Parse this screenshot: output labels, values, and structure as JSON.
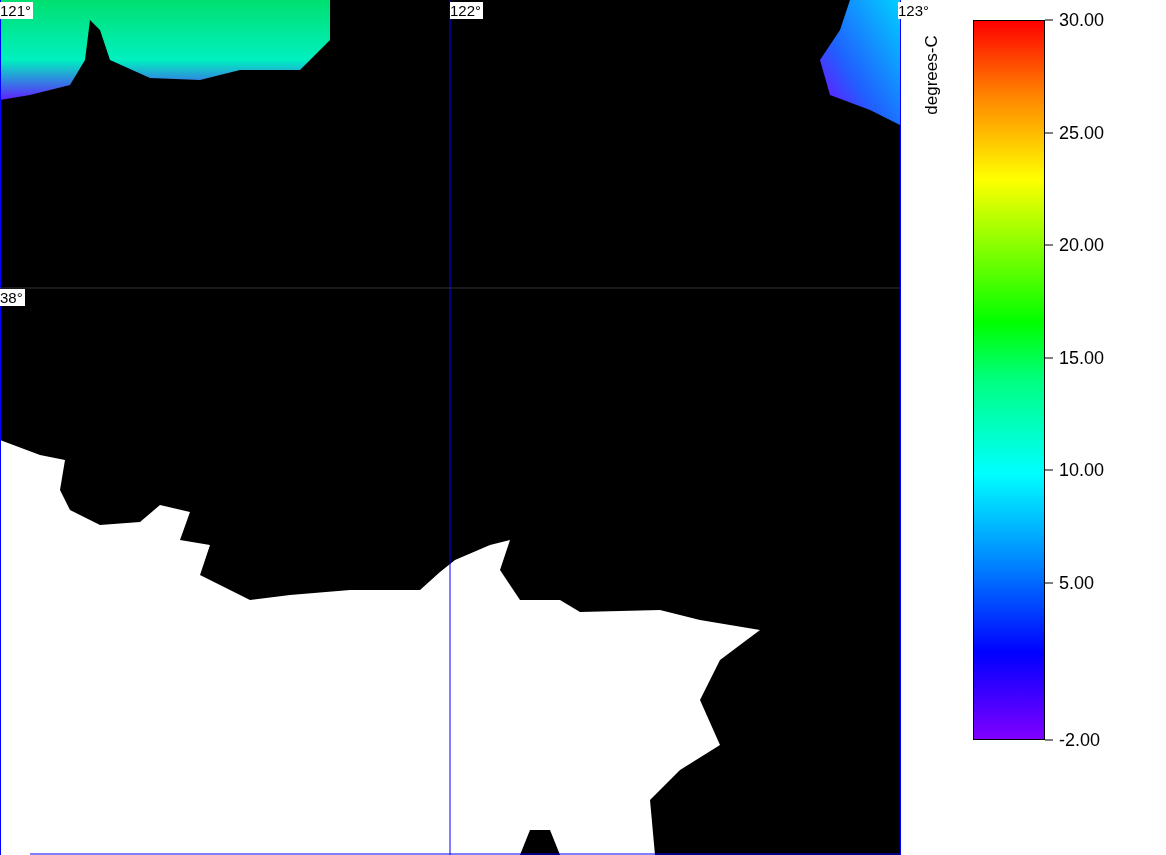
{
  "map": {
    "labels": [
      {
        "kind": "longitude",
        "text": "121°"
      },
      {
        "kind": "longitude",
        "text": "122°"
      },
      {
        "kind": "longitude",
        "text": "123°"
      },
      {
        "kind": "latitude",
        "text": "38°"
      }
    ]
  },
  "legend": {
    "title": "degrees-C",
    "ticks": [
      "30.00",
      "25.00",
      "20.00",
      "15.00",
      "10.00",
      "5.00",
      "-2.00"
    ]
  }
}
